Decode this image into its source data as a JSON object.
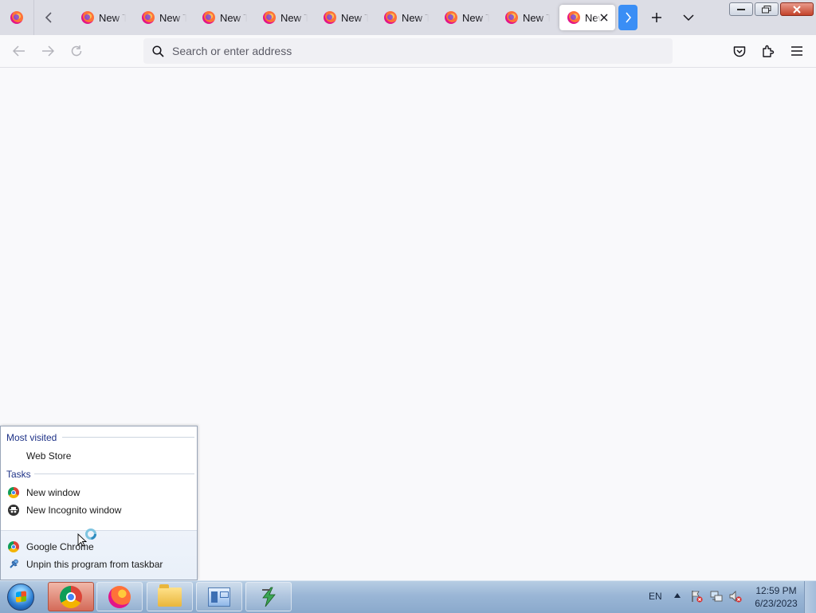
{
  "browser": {
    "tabs": [
      {
        "label": "New Tab"
      },
      {
        "label": "New Tab"
      },
      {
        "label": "New Tab"
      },
      {
        "label": "New Tab"
      },
      {
        "label": "New Tab"
      },
      {
        "label": "New Tab"
      },
      {
        "label": "New Tab"
      },
      {
        "label": "New Tab"
      },
      {
        "label": "New Tab"
      }
    ],
    "address_placeholder": "Search or enter address",
    "icons": {
      "firefox_view": "firefox-icon",
      "scroll_left": "chevron-left-icon",
      "scroll_right": "chevron-right-icon",
      "new_tab": "plus-icon",
      "list_tabs": "chevron-down-icon",
      "back": "back-arrow-icon",
      "forward": "forward-arrow-icon",
      "reload": "reload-icon",
      "search": "search-icon",
      "pocket": "pocket-icon",
      "extensions": "puzzle-icon",
      "menu": "hamburger-menu-icon"
    },
    "accent_color": "#3a8ef5"
  },
  "jumplist": {
    "most_visited_header": "Most visited",
    "most_visited_items": [
      {
        "label": "Web Store"
      }
    ],
    "tasks_header": "Tasks",
    "tasks": [
      {
        "label": "New window",
        "icon": "chrome-icon"
      },
      {
        "label": "New Incognito window",
        "icon": "incognito-icon"
      }
    ],
    "pinned": [
      {
        "label": "Google Chrome",
        "icon": "chrome-icon"
      },
      {
        "label": "Unpin this program from taskbar",
        "icon": "unpin-icon"
      }
    ]
  },
  "taskbar": {
    "apps": [
      {
        "name": "Google Chrome",
        "icon": "chrome-icon",
        "active": true
      },
      {
        "name": "Firefox",
        "icon": "firefox-icon"
      },
      {
        "name": "File Explorer",
        "icon": "folder-icon"
      },
      {
        "name": "Control Panel",
        "icon": "control-panel-icon"
      },
      {
        "name": "Power Tool",
        "icon": "lightning-icon"
      }
    ],
    "language": "EN",
    "time": "12:59 PM",
    "date": "6/23/2023"
  }
}
